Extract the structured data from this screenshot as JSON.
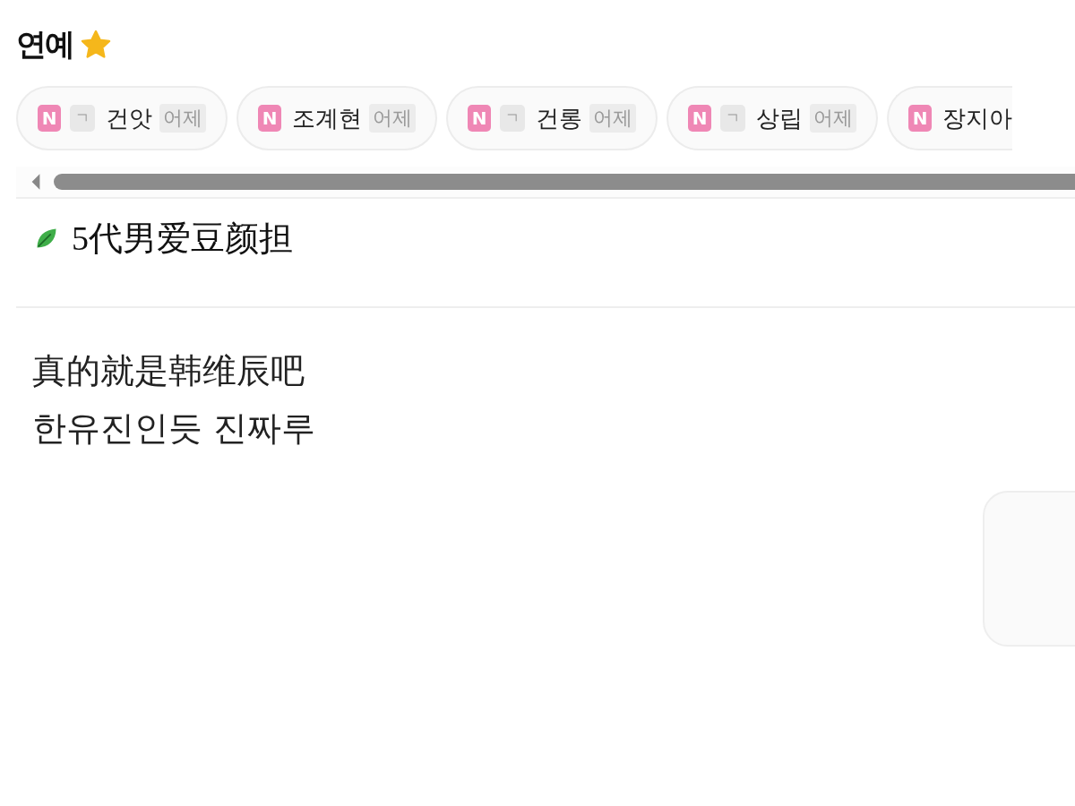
{
  "section": {
    "title": "연예"
  },
  "chips": [
    {
      "badge": "N",
      "mark": "ㄱ",
      "name": "건앗",
      "when": "어제"
    },
    {
      "badge": "N",
      "name": "조계현",
      "when": "어제"
    },
    {
      "badge": "N",
      "mark": "ㄱ",
      "name": "건롱",
      "when": "어제"
    },
    {
      "badge": "N",
      "mark": "ㄱ",
      "name": "상립",
      "when": "어제"
    },
    {
      "badge": "N",
      "name": "장지아"
    }
  ],
  "post": {
    "title": "5代男爱豆颜担",
    "lines": [
      "真的就是韩维辰吧",
      "한유진인듯 진짜루"
    ]
  }
}
